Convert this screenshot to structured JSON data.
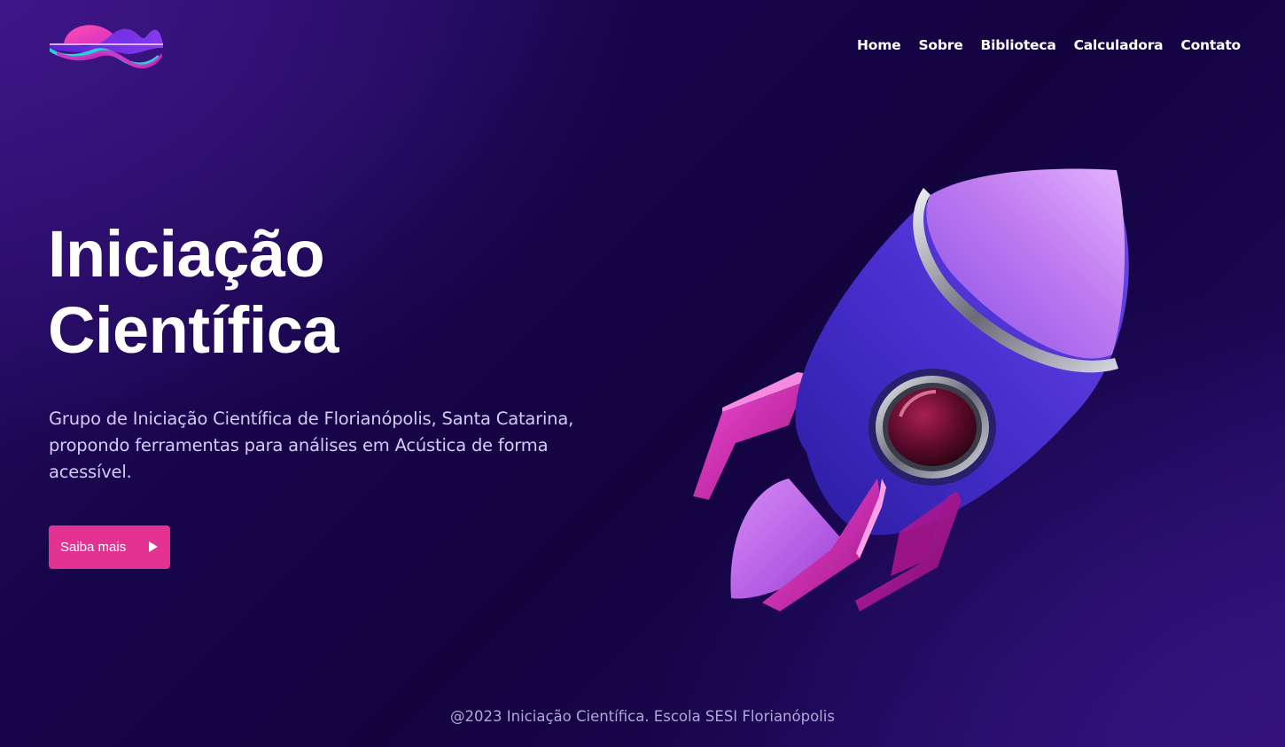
{
  "brand": {
    "logo_icon": "sound-wave-logo",
    "colors": {
      "pink": "#e33291",
      "magenta": "#d42ec4",
      "cyan": "#2ad1d6",
      "purple": "#7a2ff0"
    }
  },
  "nav": {
    "items": [
      {
        "label": "Home"
      },
      {
        "label": "Sobre"
      },
      {
        "label": "Biblioteca"
      },
      {
        "label": "Calculadora"
      },
      {
        "label": "Contato"
      }
    ]
  },
  "hero": {
    "title_line1": "Iniciação",
    "title_line2": "Científica",
    "description": "Grupo de Iniciação Científica de Florianópolis, Santa Catarina, propondo ferramentas para análises em Acústica de forma acessível.",
    "cta_label": "Saiba mais",
    "cta_icon": "play-icon",
    "illustration": "rocket-illustration"
  },
  "footer": {
    "text": "@2023 Iniciação Científica. Escola SESI Florianópolis"
  }
}
